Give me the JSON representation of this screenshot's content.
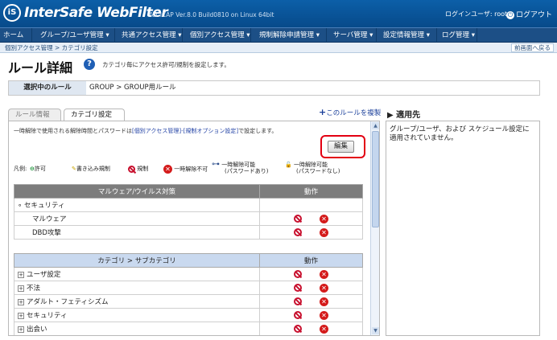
{
  "header": {
    "logo_mark": "iS",
    "brand": "InterSafe WebFilter",
    "version": "for ICAP Ver.8.0 Build0810 on Linux 64bit",
    "login_user": "ログインユーザ: root",
    "logout": "ログアウト"
  },
  "menu": [
    "ホーム",
    "グループ/ユーザ管理 ▾",
    "共通アクセス管理 ▾",
    "個別アクセス管理 ▾",
    "規制解除申請管理 ▾",
    "サーバ管理 ▾",
    "設定情報管理 ▾",
    "ログ管理 ▾"
  ],
  "breadcrumb": "個別アクセス管理 > カテゴリ設定",
  "back_link": "前画面へ戻る",
  "page": {
    "title": "ルール詳細",
    "help": "?",
    "description": "カテゴリ毎にアクセス許可/規制を設定します。"
  },
  "selected_rule": {
    "label": "選択中のルール",
    "value": "GROUP > GROUP用ルール"
  },
  "tabs": {
    "rule_info": "ルール情報",
    "category": "カテゴリ設定"
  },
  "copy_rule": "このルールを複製",
  "note": {
    "prefix": "一時解除で使用される解除時間とパスワードは",
    "link": "[個別アクセス管理]-[規制オプション設定]",
    "suffix": "で設定します。"
  },
  "edit_button": "編集",
  "legend": {
    "title": "凡例:",
    "allow": "許可",
    "write_block": "書き込み規制",
    "block": "規制",
    "no_temp_unlock": "一時解除不可",
    "unlock_pw": "一時解除可能",
    "unlock_pw_note": "(パスワードあり)",
    "unlock_nopw": "一時解除可能",
    "unlock_nopw_note": "(パスワードなし)"
  },
  "malware_table": {
    "col_name": "マルウェア/ウイルス対策",
    "col_action": "動作",
    "group": "セキュリティ",
    "rows": [
      "マルウェア",
      "DBD攻撃"
    ]
  },
  "category_table": {
    "col_name": "カテゴリ > サブカテゴリ",
    "col_action": "動作",
    "rows": [
      "ユーザ設定",
      "不法",
      "アダルト・フェティシズム",
      "セキュリティ",
      "出会い"
    ]
  },
  "apply": {
    "title": "適用先",
    "message": "グループ/ユーザ、および スケジュール設定に適用されていません。"
  },
  "colors": {
    "header": "#0c5fa8",
    "menubar": "#1c4f86",
    "highlight": "#e30012"
  }
}
